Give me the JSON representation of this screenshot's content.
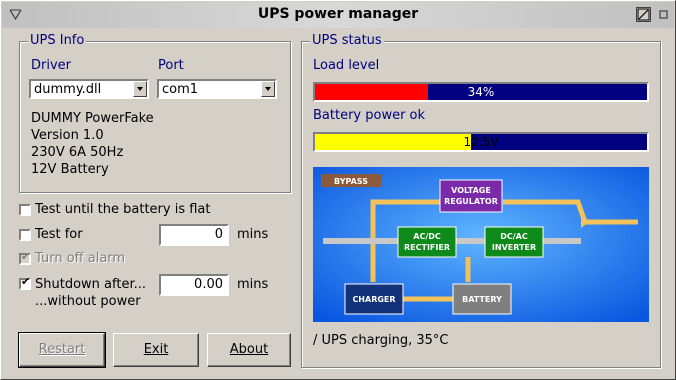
{
  "window": {
    "title": "UPS power manager"
  },
  "ups_info": {
    "legend": "UPS Info",
    "driver_label": "Driver",
    "driver_value": "dummy.dll",
    "port_label": "Port",
    "port_value": "com1",
    "device_name": "DUMMY PowerFake",
    "version": "Version 1.0",
    "specs": "230V 6A 50Hz",
    "battery": "12V Battery"
  },
  "options": {
    "test_until_flat": {
      "label": "Test until the battery is flat",
      "checked": false
    },
    "test_for": {
      "label": "Test for",
      "value": "0",
      "unit": "mins",
      "checked": false
    },
    "turn_off_alarm": {
      "label": "Turn off alarm",
      "checked": true,
      "disabled": true
    },
    "shutdown_after": {
      "label": "Shutdown after...",
      "sublabel": "...without power",
      "value": "0.00",
      "unit": "mins",
      "checked": true
    }
  },
  "buttons": {
    "restart": "Restart",
    "exit": "Exit",
    "about": "About"
  },
  "ups_status": {
    "legend": "UPS status",
    "load_label": "Load level",
    "load_value": 0.34,
    "load_text": "34%",
    "battery_label": "Battery power ok",
    "battery_value": 0.47,
    "battery_text": "12.5V",
    "status_text": "/ UPS charging, 35°C",
    "diagram": {
      "bypass": "BYPASS",
      "voltage_regulator_1": "VOLTAGE",
      "voltage_regulator_2": "REGULATOR",
      "acdc_1": "AC/DC",
      "acdc_2": "RECTIFIER",
      "dcac_1": "DC/AC",
      "dcac_2": "INVERTER",
      "charger": "CHARGER",
      "battery": "BATTERY"
    }
  },
  "colors": {
    "load_fill": "#ff0000",
    "battery_fill": "#ffff00",
    "bar_bg": "#000080",
    "legend": "#00007f",
    "diagram_bg": "#1a6cf0",
    "wire": "#f4c25a"
  }
}
